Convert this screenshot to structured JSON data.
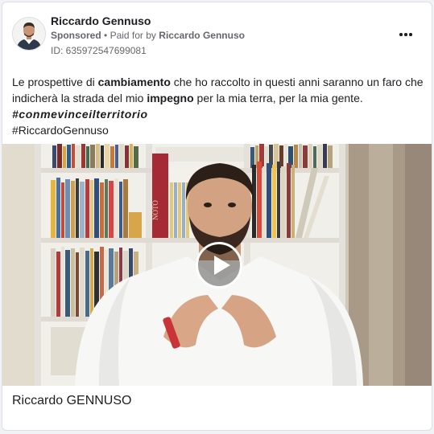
{
  "post": {
    "page_name": "Riccardo Gennuso",
    "sponsored": "Sponsored",
    "separator": "•",
    "paid_for_prefix": "Paid for by",
    "paid_for_by": "Riccardo Gennuso",
    "ad_id": "ID: 635972547699081",
    "more_icon": "more-horizontal-icon",
    "text": {
      "part1": "Le prospettive di ",
      "bold1": "cambiamento",
      "part2": " che ho raccolto in questi anni saranno un faro che indicherà la strada del mio ",
      "bold2": "impegno",
      "part3": " per la mia terra, per la mia gente.",
      "hashtag1": "#conmevinceilterritorio",
      "hashtag2": "#RiccardoGennuso"
    },
    "video": {
      "book_spine_text": "NOTO",
      "play_icon": "play-icon"
    },
    "caption": "Riccardo GENNUSO"
  },
  "colors": {
    "background": "#f0f2f5",
    "card": "#ffffff",
    "secondary_text": "#65676b",
    "primary_text": "#1c1e21"
  }
}
